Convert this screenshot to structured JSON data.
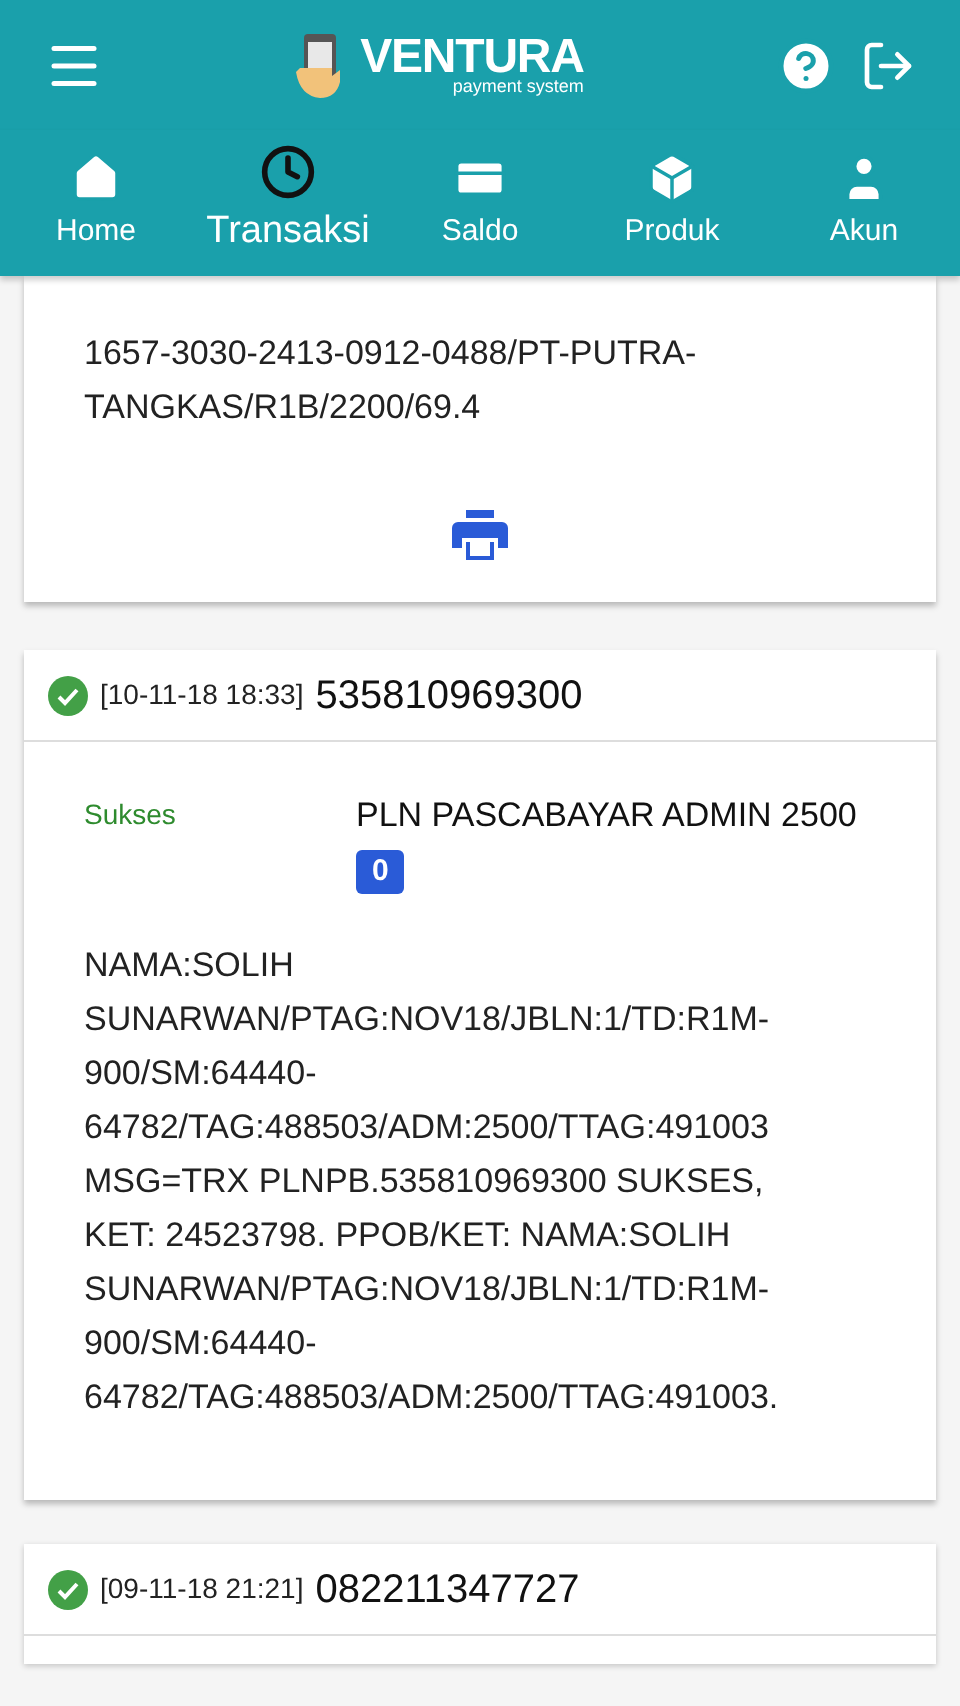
{
  "app_bar": {
    "brand": "VENTURA",
    "tagline": "payment system"
  },
  "tabs": [
    {
      "label": "Home",
      "selected": false
    },
    {
      "label": "Transaksi",
      "selected": true
    },
    {
      "label": "Saldo",
      "selected": false
    },
    {
      "label": "Produk",
      "selected": false
    },
    {
      "label": "Akun",
      "selected": false
    }
  ],
  "transactions": [
    {
      "kind": "tail",
      "details": "1657-3030-2413-0912-0488/PT-PUTRA-TANGKAS/R1B/2200/69.4"
    },
    {
      "kind": "full",
      "success": true,
      "timestamp": "[10-11-18 18:33]",
      "number": "535810969300",
      "status": "Sukses",
      "product": "PLN PASCABAYAR ADMIN 2500",
      "count": "0",
      "details": "NAMA:SOLIH SUNARWAN/PTAG:NOV18/JBLN:1/TD:R1M-900/SM:64440-64782/TAG:488503/ADM:2500/TTAG:491003 MSG=TRX PLNPB.535810969300 SUKSES, KET: 24523798. PPOB/KET: NAMA:SOLIH SUNARWAN/PTAG:NOV18/JBLN:1/TD:R1M-900/SM:64440-64782/TAG:488503/ADM:2500/TTAG:491003."
    },
    {
      "kind": "header",
      "success": true,
      "timestamp": "[09-11-18 21:21]",
      "number": "082211347727"
    }
  ]
}
